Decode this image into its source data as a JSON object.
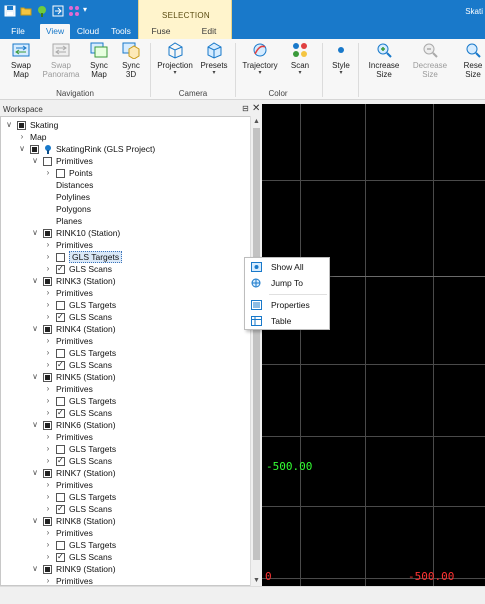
{
  "titlebar": {
    "app_title": "Skati",
    "context_group": "SELECTION"
  },
  "tabs": [
    {
      "label": "File"
    },
    {
      "label": "View"
    },
    {
      "label": "Cloud"
    },
    {
      "label": "Tools"
    },
    {
      "label": "Fuse"
    },
    {
      "label": "Edit"
    }
  ],
  "ribbon": {
    "navigation": {
      "label": "Navigation",
      "swap_map": [
        "Swap",
        "Map"
      ],
      "swap_panorama": [
        "Swap",
        "Panorama"
      ],
      "sync_map": [
        "Sync",
        "Map"
      ],
      "sync_3d": [
        "Sync",
        "3D"
      ]
    },
    "camera": {
      "label": "Camera",
      "projection": "Projection",
      "presets": "Presets"
    },
    "color": {
      "label": "Color",
      "trajectory": "Trajectory",
      "scan": "Scan"
    },
    "style": "Style",
    "increase_size": [
      "Increase",
      "Size"
    ],
    "decrease_size": [
      "Decrease",
      "Size"
    ],
    "reset_size": [
      "Rese",
      "Size"
    ],
    "dropdown_glyph": "▾"
  },
  "workspace": {
    "title": "Workspace",
    "pin_glyph": "⊟",
    "close_glyph": "✕",
    "tree": [
      {
        "label": "Skating"
      },
      {
        "label": "Map"
      },
      {
        "label": "SkatingRink (GLS Project)"
      },
      {
        "label": "Primitives"
      },
      {
        "label": "Points"
      },
      {
        "label": "Distances"
      },
      {
        "label": "Polylines"
      },
      {
        "label": "Polygons"
      },
      {
        "label": "Planes"
      },
      {
        "label": "RINK10 (Station)"
      },
      {
        "label": "Primitives"
      },
      {
        "label": "GLS Targets"
      },
      {
        "label": "GLS Scans"
      },
      {
        "label": "RINK3 (Station)"
      },
      {
        "label": "Primitives"
      },
      {
        "label": "GLS Targets"
      },
      {
        "label": "GLS Scans"
      },
      {
        "label": "RINK4 (Station)"
      },
      {
        "label": "Primitives"
      },
      {
        "label": "GLS Targets"
      },
      {
        "label": "GLS Scans"
      },
      {
        "label": "RINK5 (Station)"
      },
      {
        "label": "Primitives"
      },
      {
        "label": "GLS Targets"
      },
      {
        "label": "GLS Scans"
      },
      {
        "label": "RINK6 (Station)"
      },
      {
        "label": "Primitives"
      },
      {
        "label": "GLS Targets"
      },
      {
        "label": "GLS Scans"
      },
      {
        "label": "RINK7 (Station)"
      },
      {
        "label": "Primitives"
      },
      {
        "label": "GLS Targets"
      },
      {
        "label": "GLS Scans"
      },
      {
        "label": "RINK8 (Station)"
      },
      {
        "label": "Primitives"
      },
      {
        "label": "GLS Targets"
      },
      {
        "label": "GLS Scans"
      },
      {
        "label": "RINK9 (Station)"
      },
      {
        "label": "Primitives"
      }
    ]
  },
  "viewer": {
    "coord_left": "-500.00",
    "coord_bottom_left": "0",
    "coord_bottom_right": "-500.00",
    "colors": {
      "green": "#33ff33",
      "red": "#ff3333",
      "grid": "#4a4a4a"
    }
  },
  "context_menu": {
    "items": [
      {
        "label": "Show All"
      },
      {
        "label": "Jump To"
      },
      {
        "label": "Properties"
      },
      {
        "label": "Table"
      }
    ]
  },
  "colors": {
    "accent": "#1979ca",
    "context_tab": "#fff4cc"
  }
}
